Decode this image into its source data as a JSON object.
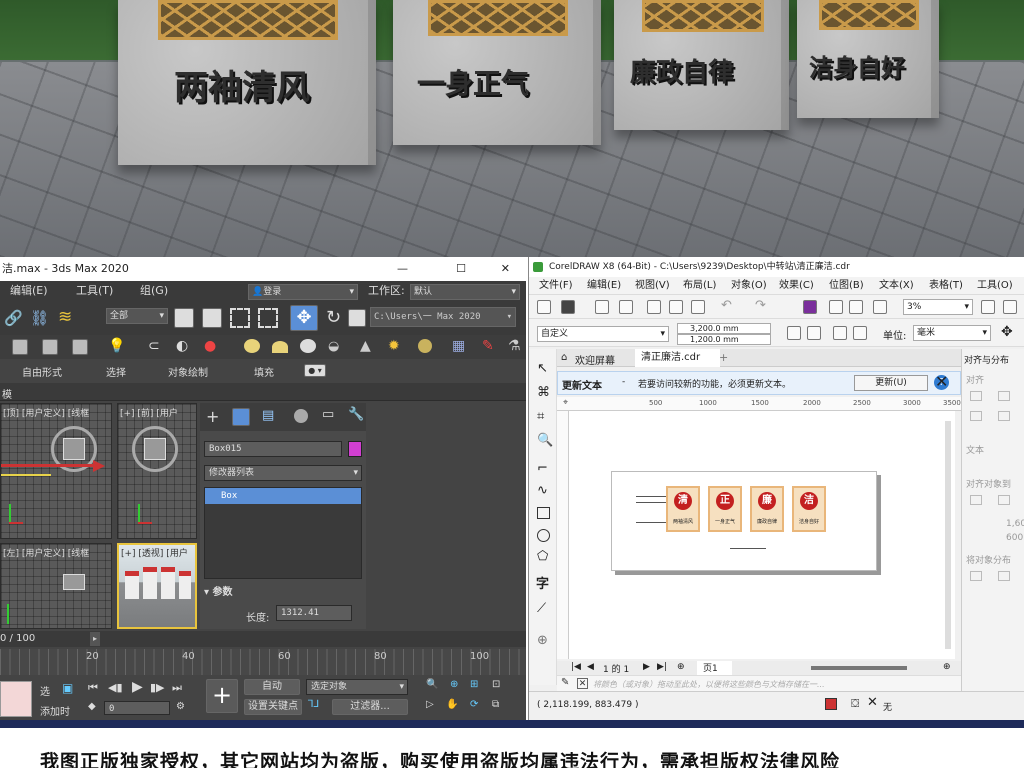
{
  "scene": {
    "mottos": [
      "两袖清风",
      "一身正气",
      "廉政自律",
      "洁身自好"
    ]
  },
  "max": {
    "title": "洁.max - 3ds Max 2020",
    "window_buttons": [
      "—",
      "☐",
      "✕"
    ],
    "menu": [
      "编辑(E)",
      "工具(T)",
      "组(G)"
    ],
    "login": "登录",
    "workspace_label": "工作区:",
    "workspace_value": "默认",
    "selection_filter": "全部",
    "path": "C:\\Users\\一 Max 2020",
    "ribbon_tabs": [
      "自由形式",
      "选择",
      "对象绘制",
      "填充"
    ],
    "ribbon_label": "模",
    "viewports": {
      "top_left": "[顶] [用户定义] [线框",
      "top_right": "[+] [前] [用户",
      "bottom_left": "[左] [用户定义] [线框",
      "bottom_right": "[+] [透视] [用户"
    },
    "object_name": "Box015",
    "modifier_list": "修改器列表",
    "modifier_item": "Box",
    "params_title": "参数",
    "length_label": "长度:",
    "length_value": "1312.41",
    "frame_counter": "0 / 100",
    "timeline_ticks": [
      "20",
      "40",
      "60",
      "80",
      "100"
    ],
    "bottom": {
      "auto_key": "自动",
      "selected": "选定对象",
      "set_key": "设置关键点",
      "filters": "过滤器...",
      "frame": "0",
      "left_labels": [
        "选",
        "添加时"
      ]
    }
  },
  "cdr": {
    "title": "CorelDRAW X8 (64-Bit) - C:\\Users\\9239\\Desktop\\中转站\\清正廉洁.cdr",
    "menu": [
      "文件(F)",
      "编辑(E)",
      "视图(V)",
      "布局(L)",
      "对象(O)",
      "效果(C)",
      "位图(B)",
      "文本(X)",
      "表格(T)",
      "工具(O)"
    ],
    "zoom": "3%",
    "page_size": "自定义",
    "width_value": "3,200.0 mm",
    "height_value": "1,200.0 mm",
    "unit_label": "单位:",
    "unit_value": "毫米",
    "tabs": [
      "欢迎屏幕",
      "清正廉洁.cdr"
    ],
    "update_title": "更新文本",
    "update_message": "若要访问较新的功能，必须更新文本。",
    "update_button": "更新(U)",
    "docker_title": "对齐与分布",
    "docker_items": [
      "对齐",
      "文本",
      "对齐对象到",
      "将对象分布"
    ],
    "docker_values": [
      "1,60",
      "600"
    ],
    "ruler_ticks": [
      "500",
      "1000",
      "1500",
      "2000",
      "2500",
      "3000",
      "3500"
    ],
    "page_nav": "1 的 1",
    "page_tab": "页1",
    "color_hint": "将颜色（或对象）拖动至此处，以便将这些颜色与文档存储在一...",
    "coords": "( 2,118.199, 883.479 )",
    "fill_label": "无",
    "boards": [
      "两袖清风",
      "一身正气",
      "廉政自律",
      "洁身自好"
    ],
    "boards_glyph": [
      "清",
      "正",
      "廉",
      "洁"
    ]
  },
  "banner": {
    "text": "我图正版独家授权，其它网站均为盗版，购买使用盗版均属违法行为，需承担版权法律风险"
  },
  "colors": {
    "max_bg": "#444444",
    "cdr_bg": "#f0f0f0",
    "accent_blue": "#2f7bd1",
    "board_red": "#c32020",
    "lattice_gold": "#c99a4a"
  }
}
